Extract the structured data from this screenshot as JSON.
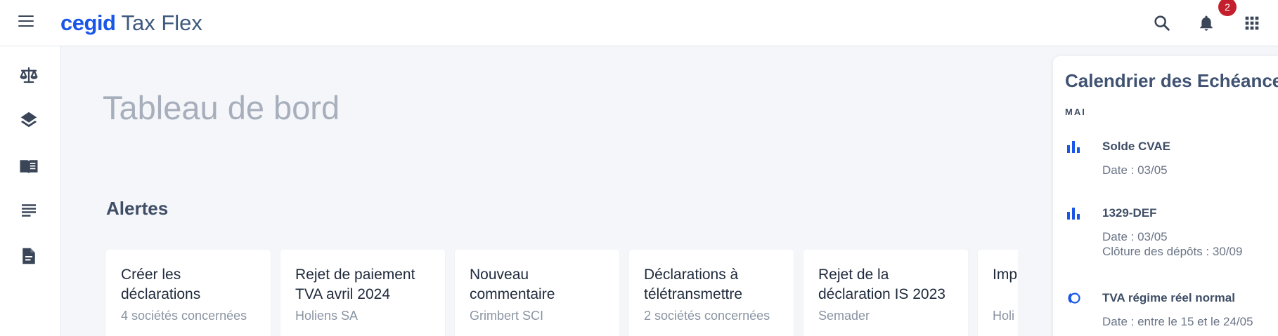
{
  "header": {
    "brand_name": "cegid",
    "product_name": "Tax Flex",
    "notification_count": "2",
    "icons": [
      "menu-icon",
      "search-icon",
      "bell-icon",
      "apps-grid-icon"
    ],
    "accent_color": "#1a57e8",
    "badge_color": "#c41f2c"
  },
  "rail": {
    "icons": [
      "balance-scale-icon",
      "layers-icon",
      "book-icon",
      "text-lines-icon",
      "document-icon"
    ]
  },
  "main": {
    "title": "Tableau de bord",
    "alerts_title": "Alertes",
    "alerts": [
      {
        "title": "Créer les déclarations",
        "subtitle": "4 sociétés concernées"
      },
      {
        "title": "Rejet de paiement TVA avril 2024",
        "subtitle": "Holiens SA"
      },
      {
        "title": "Nouveau commentaire",
        "subtitle": "Grimbert SCI"
      },
      {
        "title": "Déclarations à télétransmettre",
        "subtitle": "2 sociétés concernées"
      },
      {
        "title": "Rejet de la déclaration IS 2023",
        "subtitle": "Semader"
      },
      {
        "title": "Imp",
        "subtitle": "Holi"
      }
    ]
  },
  "calendar": {
    "title": "Calendrier des Echéances",
    "month": "MAI",
    "events": [
      {
        "icon": "bar-chart-icon",
        "title": "Solde CVAE",
        "line1": "Date : 03/05",
        "line2": ""
      },
      {
        "icon": "bar-chart-icon",
        "title": "1329-DEF",
        "line1": "Date : 03/05",
        "line2": "Clôture des dépôts : 30/09"
      },
      {
        "icon": "rings-icon",
        "title": "TVA régime réel normal",
        "line1": "Date : entre le 15 et le 24/05",
        "line2": ""
      }
    ]
  }
}
